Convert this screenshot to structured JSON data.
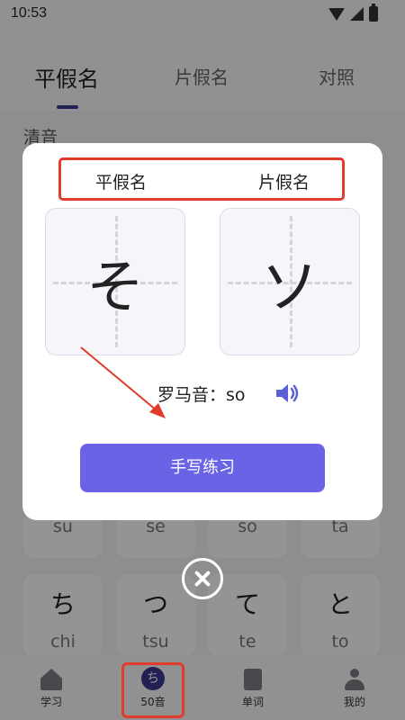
{
  "status_bar": {
    "time": "10:53"
  },
  "top_tabs": [
    {
      "label": "平假名"
    },
    {
      "label": "片假名"
    },
    {
      "label": "对照"
    }
  ],
  "section": {
    "title": "清音"
  },
  "grid": {
    "partial_row": [
      {
        "romaji": "su"
      },
      {
        "romaji": "se"
      },
      {
        "romaji": "so"
      },
      {
        "romaji": "ta"
      }
    ],
    "full_row": [
      {
        "kana": "ち",
        "romaji": "chi"
      },
      {
        "kana": "つ",
        "romaji": "tsu"
      },
      {
        "kana": "て",
        "romaji": "te"
      },
      {
        "kana": "と",
        "romaji": "to"
      }
    ]
  },
  "bottom_nav": [
    {
      "label": "学习",
      "icon": "home-icon"
    },
    {
      "label": "50音",
      "icon": "chi-badge-icon",
      "icon_text": "ち"
    },
    {
      "label": "单词",
      "icon": "book-icon"
    },
    {
      "label": "我的",
      "icon": "user-icon"
    }
  ],
  "modal": {
    "tab_hiragana": "平假名",
    "tab_katakana": "片假名",
    "hiragana_char": "そ",
    "katakana_char": "ソ",
    "romaji_label": "罗马音：",
    "romaji_value": "so",
    "practice_button": "手写练习"
  },
  "colors": {
    "accent": "#6a63e6",
    "indicator": "#3d3a8f",
    "annotation": "#e23b2b",
    "speaker": "#5c5fd6"
  }
}
